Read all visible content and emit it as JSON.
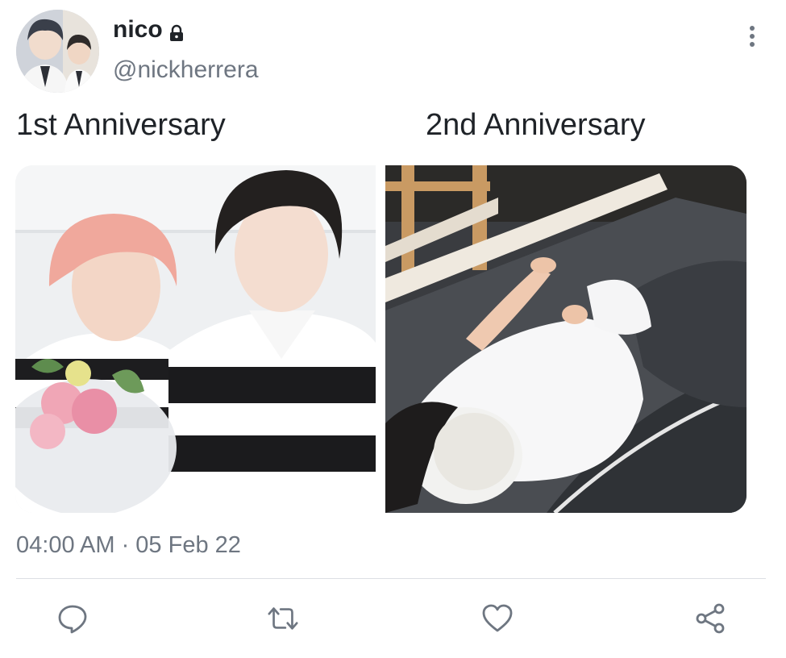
{
  "author": {
    "display_name": "nico",
    "handle": "@nickherrera",
    "protected_icon": "lock-icon",
    "avatar_alt": "profile photo"
  },
  "post": {
    "captions": [
      "1st Anniversary",
      "2nd Anniversary"
    ],
    "images": [
      {
        "label": "photo of two people, one holding a pink bouquet"
      },
      {
        "label": "photo of a person sleeping with a face mask on a bed"
      }
    ],
    "timestamp": "04:00 AM · 05 Feb 22"
  },
  "menu": {
    "icon": "more-vertical-icon"
  },
  "actions": [
    {
      "icon": "reply-icon"
    },
    {
      "icon": "retweet-icon"
    },
    {
      "icon": "like-icon"
    },
    {
      "icon": "share-icon"
    }
  ],
  "colors": {
    "primary_text": "#1f2328",
    "secondary_text": "#6e7681",
    "divider": "#dcdfe3",
    "icon": "#6e7681"
  }
}
